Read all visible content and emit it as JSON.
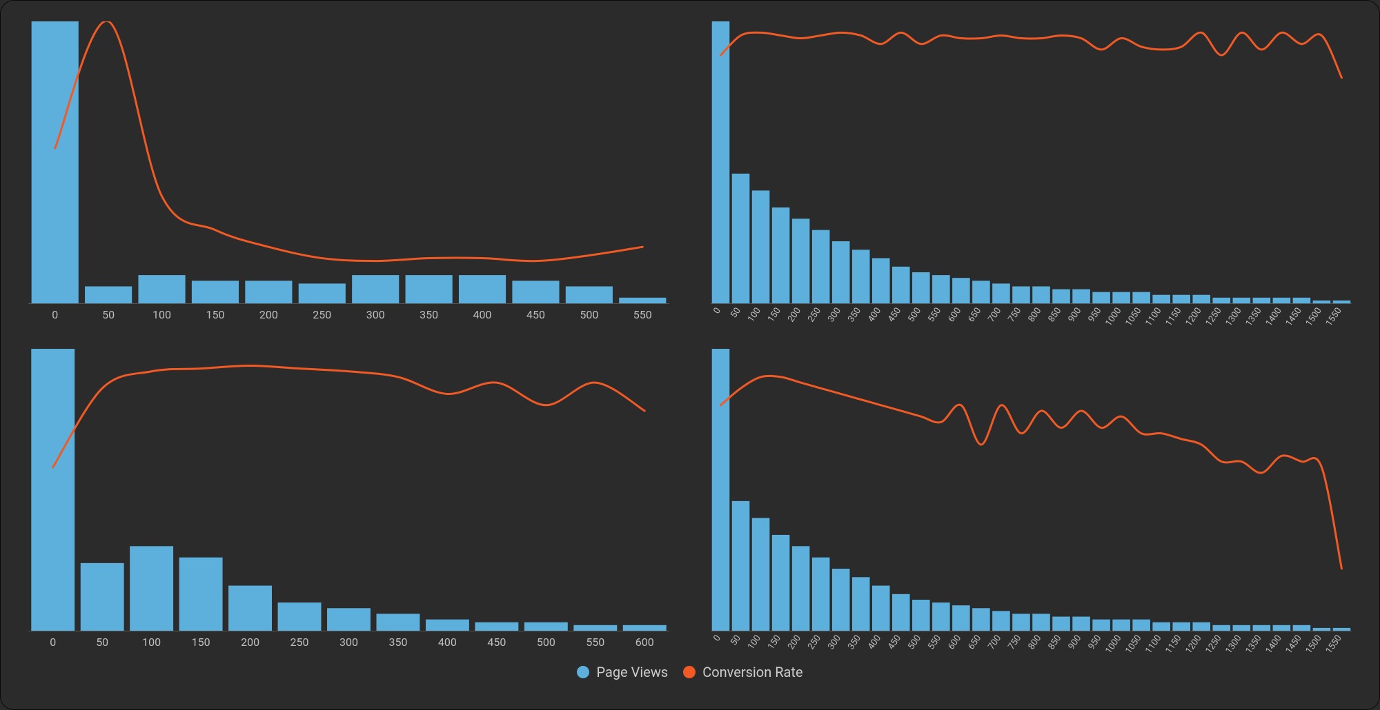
{
  "legend": {
    "bars": "Page Views",
    "line": "Conversion Rate"
  },
  "colors": {
    "bars": "#5eb0dc",
    "line": "#f15a24",
    "bg": "#2b2b2b",
    "text": "#cccccc"
  },
  "chart_data": [
    {
      "type": "bar+line",
      "categories": [
        0,
        50,
        100,
        150,
        200,
        250,
        300,
        350,
        400,
        450,
        500,
        550
      ],
      "bars": [
        100,
        6,
        10,
        8,
        8,
        7,
        10,
        10,
        10,
        8,
        6,
        2
      ],
      "line": [
        55,
        100,
        38,
        26,
        20,
        16,
        15,
        16,
        16,
        15,
        17,
        20
      ],
      "bars_label": "Page Views",
      "line_label": "Conversion Rate",
      "bars_ylim": [
        0,
        100
      ],
      "line_ylim": [
        0,
        100
      ]
    },
    {
      "type": "bar+line",
      "categories": [
        0,
        50,
        100,
        150,
        200,
        250,
        300,
        350,
        400,
        450,
        500,
        550,
        600,
        650,
        700,
        750,
        800,
        850,
        900,
        950,
        1000,
        1050,
        1100,
        1150,
        1200,
        1250,
        1300,
        1350,
        1400,
        1450,
        1500,
        1550
      ],
      "bars": [
        100,
        46,
        40,
        34,
        30,
        26,
        22,
        19,
        16,
        13,
        11,
        10,
        9,
        8,
        7,
        6,
        6,
        5,
        5,
        4,
        4,
        4,
        3,
        3,
        3,
        2,
        2,
        2,
        2,
        2,
        1,
        1
      ],
      "line": [
        88,
        95,
        96,
        95,
        94,
        95,
        96,
        95,
        92,
        96,
        92,
        95,
        94,
        94,
        95,
        94,
        94,
        95,
        94,
        90,
        94,
        91,
        90,
        91,
        96,
        88,
        96,
        90,
        96,
        92,
        95,
        80
      ],
      "bars_label": "Page Views",
      "line_label": "Conversion Rate",
      "bars_ylim": [
        0,
        100
      ],
      "line_ylim": [
        0,
        100
      ]
    },
    {
      "type": "bar+line",
      "categories": [
        0,
        50,
        100,
        150,
        200,
        250,
        300,
        350,
        400,
        450,
        500,
        550,
        600
      ],
      "bars": [
        100,
        24,
        30,
        26,
        16,
        10,
        8,
        6,
        4,
        3,
        3,
        2,
        2
      ],
      "line": [
        58,
        86,
        92,
        93,
        94,
        93,
        92,
        90,
        84,
        88,
        80,
        88,
        78
      ],
      "bars_label": "Page Views",
      "line_label": "Conversion Rate",
      "bars_ylim": [
        0,
        100
      ],
      "line_ylim": [
        0,
        100
      ]
    },
    {
      "type": "bar+line",
      "categories": [
        0,
        50,
        100,
        150,
        200,
        250,
        300,
        350,
        400,
        450,
        500,
        550,
        600,
        650,
        700,
        750,
        800,
        850,
        900,
        950,
        1000,
        1050,
        1100,
        1150,
        1200,
        1250,
        1300,
        1350,
        1400,
        1450,
        1500,
        1550
      ],
      "bars": [
        100,
        46,
        40,
        34,
        30,
        26,
        22,
        19,
        16,
        13,
        11,
        10,
        9,
        8,
        7,
        6,
        6,
        5,
        5,
        4,
        4,
        4,
        3,
        3,
        3,
        2,
        2,
        2,
        2,
        2,
        1,
        1
      ],
      "line": [
        80,
        86,
        90,
        90,
        88,
        86,
        84,
        82,
        80,
        78,
        76,
        74,
        80,
        66,
        80,
        70,
        78,
        72,
        78,
        72,
        76,
        70,
        70,
        68,
        66,
        60,
        60,
        56,
        62,
        60,
        58,
        22
      ],
      "bars_label": "Page Views",
      "line_label": "Conversion Rate",
      "bars_ylim": [
        0,
        100
      ],
      "line_ylim": [
        0,
        100
      ]
    }
  ]
}
